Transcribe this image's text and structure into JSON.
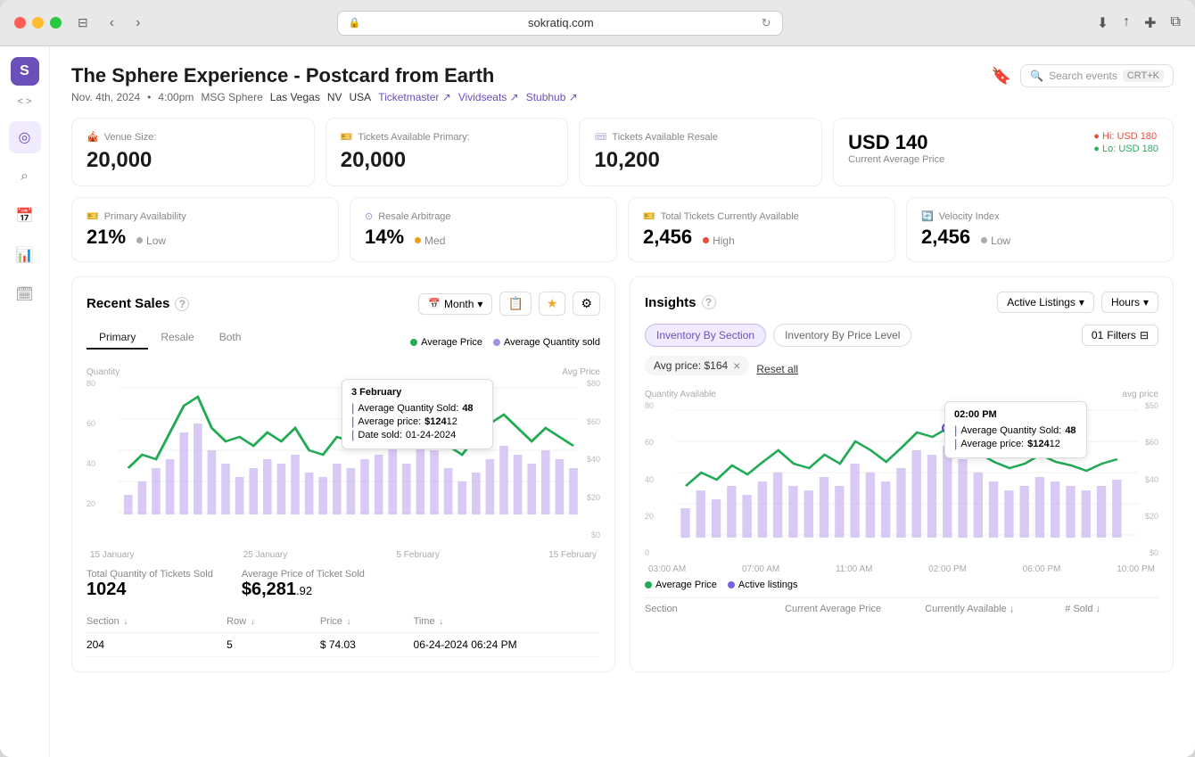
{
  "browser": {
    "url": "sokratiq.com",
    "back_btn": "‹",
    "forward_btn": "›"
  },
  "header": {
    "title": "The Sphere Experience - Postcard from Earth",
    "date": "Nov. 4th, 2024",
    "time": "4:00pm",
    "venue": "MSG Sphere",
    "city": "Las Vegas",
    "state": "NV",
    "country": "USA",
    "links": [
      "Ticketmaster ↗",
      "Vividseats ↗",
      "Stubhub ↗"
    ],
    "search_placeholder": "Search events",
    "search_shortcut": "CRT+K",
    "bookmark_icon": "🔖"
  },
  "stats": {
    "venue_size_label": "Venue Size:",
    "venue_size_value": "20,000",
    "tickets_primary_label": "Tickets Available Primary:",
    "tickets_primary_value": "20,000",
    "tickets_resale_label": "Tickets Available Resale",
    "tickets_resale_value": "10,200",
    "price_label": "USD 140",
    "price_sub": "Current Average Price",
    "price_hi": "Hi: USD 180",
    "price_lo": "Lo: USD 180",
    "primary_avail_label": "Primary Availability",
    "primary_avail_value": "21%",
    "primary_avail_badge": "Low",
    "resale_arb_label": "Resale Arbitrage",
    "resale_arb_value": "14%",
    "resale_arb_badge": "Med",
    "total_tickets_label": "Total Tickets Currently Available",
    "total_tickets_value": "2,456",
    "total_tickets_badge": "High",
    "velocity_label": "Velocity Index",
    "velocity_value": "2,456",
    "velocity_badge": "Low"
  },
  "recent_sales": {
    "title": "Recent Sales",
    "period_label": "Month",
    "tabs": [
      "Primary",
      "Resale",
      "Both"
    ],
    "active_tab": "Primary",
    "legend_avg_price": "Average Price",
    "legend_avg_qty": "Average Quantity sold",
    "x_labels": [
      "15 January",
      "25 January",
      "5 February",
      "15 February"
    ],
    "qty_label": "Quantity",
    "avg_price_label": "Avg Price",
    "y_qty": [
      "80",
      "60",
      "40",
      "20"
    ],
    "y_avg": [
      "$80",
      "$60",
      "$40",
      "$20",
      "$0"
    ],
    "tooltip": {
      "date": "3 February",
      "avg_qty_label": "Average Quantity Sold:",
      "avg_qty_value": "48",
      "avg_price_label": "Average price:",
      "avg_price_value": "$124",
      "avg_price_decimal": "12",
      "date_sold_label": "Date sold:",
      "date_sold_value": "01-24-2024"
    },
    "total_qty_label": "Total Quantity of Tickets Sold",
    "total_qty_value": "1024",
    "avg_price_sold_label": "Average Price of Ticket Sold",
    "avg_price_sold_value": "$6,281",
    "avg_price_sold_decimal": ".92",
    "table_headers": [
      "Section",
      "Row",
      "Price",
      "Time"
    ],
    "table_rows": [
      {
        "section": "204",
        "row": "5",
        "price": "$ 74.03",
        "time": "06-24-2024 06:24 PM"
      }
    ]
  },
  "insights": {
    "title": "Insights",
    "dropdown1_label": "Active Listings",
    "dropdown2_label": "Hours",
    "tabs": [
      "Inventory By Section",
      "Inventory By Price Level"
    ],
    "active_tab": "Inventory By Section",
    "filter_btn": "Filters",
    "filter_pill": "Avg price: $164",
    "reset_label": "Reset all",
    "qty_label": "Quantity Available",
    "avg_price_label": "avg price",
    "x_labels": [
      "03:00 AM",
      "07:00 AM",
      "11:00 AM",
      "02:00 PM",
      "06:00 PM",
      "10:00 PM"
    ],
    "y_qty": [
      "80",
      "60",
      "40",
      "20",
      "0"
    ],
    "y_avg": [
      "$50",
      "$60",
      "$40",
      "$20",
      "$0"
    ],
    "tooltip": {
      "time": "02:00 PM",
      "avg_qty_label": "Average Quantity Sold:",
      "avg_qty_value": "48",
      "avg_price_label": "Average price:",
      "avg_price_value": "$124",
      "avg_price_decimal": "12"
    },
    "legend_avg_price": "Average Price",
    "legend_active": "Active listings",
    "table_headers": [
      "Section",
      "Current Average Price",
      "Currently Available",
      "# Sold"
    ]
  },
  "sidebar": {
    "logo": "S",
    "code": "< >",
    "icons": [
      {
        "name": "target-icon",
        "symbol": "◎",
        "active": true
      },
      {
        "name": "search-icon",
        "symbol": "⌕",
        "active": false
      },
      {
        "name": "calendar-icon",
        "symbol": "📅",
        "active": false
      },
      {
        "name": "chart-icon",
        "symbol": "📊",
        "active": false
      },
      {
        "name": "calendar2-icon",
        "symbol": "🗓",
        "active": false
      }
    ]
  }
}
